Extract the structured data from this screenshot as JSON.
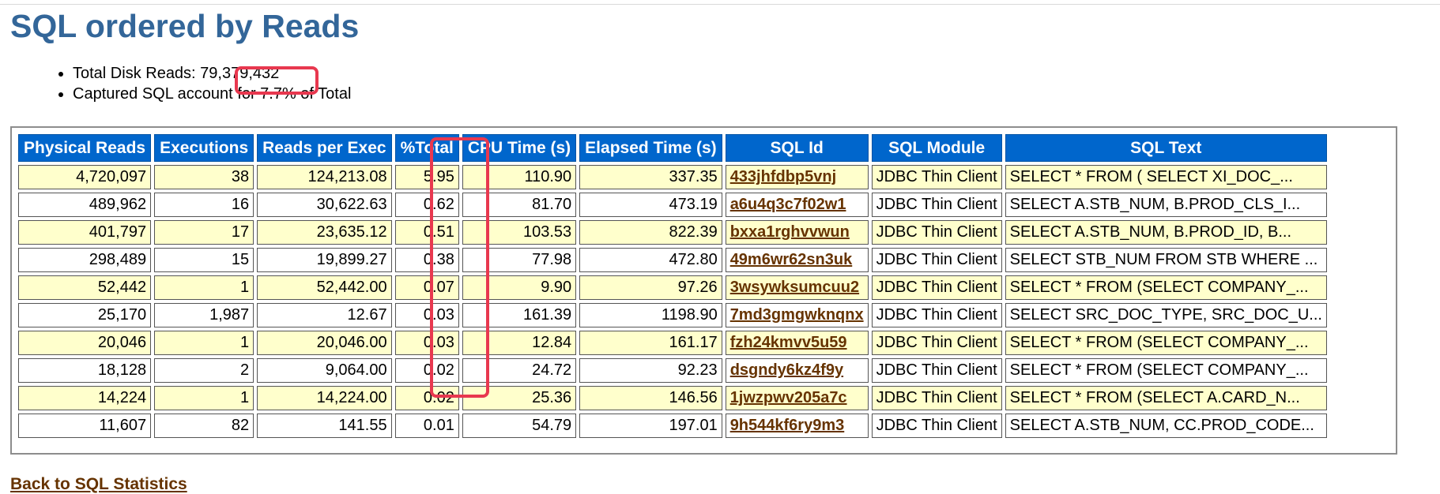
{
  "title": "SQL ordered by Reads",
  "summary": [
    "Total Disk Reads: 79,379,432",
    "Captured SQL account for 7.7% of Total"
  ],
  "table": {
    "headers": [
      "Physical Reads",
      "Executions",
      "Reads per Exec",
      "%Total",
      "CPU Time (s)",
      "Elapsed Time (s)",
      "SQL Id",
      "SQL Module",
      "SQL Text"
    ],
    "rows": [
      [
        "4,720,097",
        "38",
        "124,213.08",
        "5.95",
        "110.90",
        "337.35",
        "433jhfdbp5vnj",
        "JDBC Thin Client",
        "SELECT * FROM ( SELECT XI_DOC_..."
      ],
      [
        "489,962",
        "16",
        "30,622.63",
        "0.62",
        "81.70",
        "473.19",
        "a6u4q3c7f02w1",
        "JDBC Thin Client",
        "SELECT A.STB_NUM, B.PROD_CLS_I..."
      ],
      [
        "401,797",
        "17",
        "23,635.12",
        "0.51",
        "103.53",
        "822.39",
        "bxxa1rghvvwun",
        "JDBC Thin Client",
        "SELECT A.STB_NUM, B.PROD_ID, B..."
      ],
      [
        "298,489",
        "15",
        "19,899.27",
        "0.38",
        "77.98",
        "472.80",
        "49m6wr62sn3uk",
        "JDBC Thin Client",
        "SELECT STB_NUM FROM STB WHERE ..."
      ],
      [
        "52,442",
        "1",
        "52,442.00",
        "0.07",
        "9.90",
        "97.26",
        "3wsywksumcuu2",
        "JDBC Thin Client",
        "SELECT * FROM (SELECT COMPANY_..."
      ],
      [
        "25,170",
        "1,987",
        "12.67",
        "0.03",
        "161.39",
        "1198.90",
        "7md3gmgwknqnx",
        "JDBC Thin Client",
        "SELECT SRC_DOC_TYPE, SRC_DOC_U..."
      ],
      [
        "20,046",
        "1",
        "20,046.00",
        "0.03",
        "12.84",
        "161.17",
        "fzh24kmvv5u59",
        "JDBC Thin Client",
        "SELECT * FROM (SELECT COMPANY_..."
      ],
      [
        "18,128",
        "2",
        "9,064.00",
        "0.02",
        "24.72",
        "92.23",
        "dsgndy6kz4f9y",
        "JDBC Thin Client",
        "SELECT * FROM (SELECT COMPANY_..."
      ],
      [
        "14,224",
        "1",
        "14,224.00",
        "0.02",
        "25.36",
        "146.56",
        "1jwzpwv205a7c",
        "JDBC Thin Client",
        "SELECT * FROM (SELECT A.CARD_N..."
      ],
      [
        "11,607",
        "82",
        "141.55",
        "0.01",
        "54.79",
        "197.01",
        "9h544kf6ry9m3",
        "JDBC Thin Client",
        "SELECT A.STB_NUM, CC.PROD_CODE..."
      ]
    ]
  },
  "back_link": "Back to SQL Statistics",
  "colors": {
    "title": "#336699",
    "header_bg": "#0066cc",
    "odd_row_bg": "#ffffcc",
    "link": "#663300",
    "highlight": "#e8384f"
  }
}
